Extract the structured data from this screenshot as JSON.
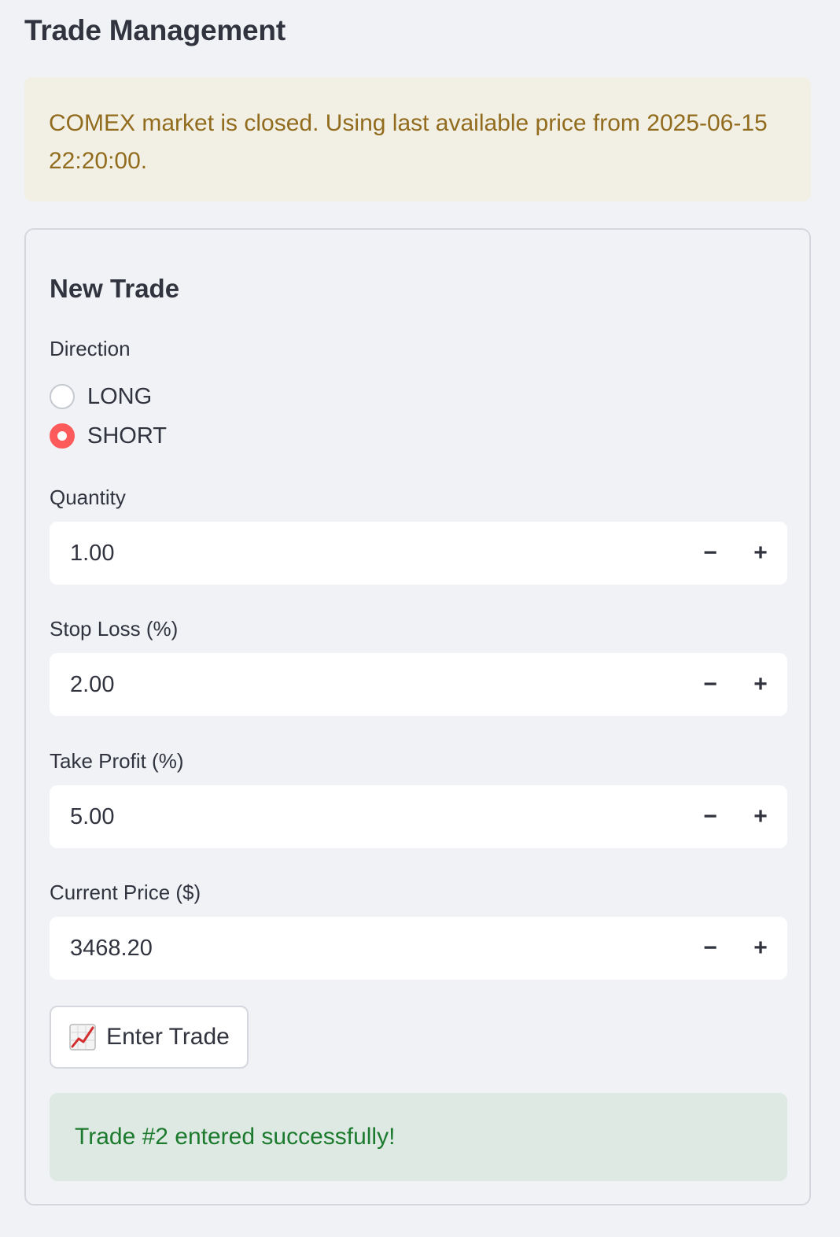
{
  "page": {
    "title": "Trade Management"
  },
  "alerts": {
    "warning": "COMEX market is closed. Using last available price from 2025-06-15 22:20:00.",
    "success": "Trade #2 entered successfully!"
  },
  "form": {
    "title": "New Trade",
    "direction": {
      "label": "Direction",
      "options": [
        "LONG",
        "SHORT"
      ],
      "selected": "SHORT"
    },
    "quantity": {
      "label": "Quantity",
      "value": "1.00"
    },
    "stop_loss": {
      "label": "Stop Loss (%)",
      "value": "2.00"
    },
    "take_profit": {
      "label": "Take Profit (%)",
      "value": "5.00"
    },
    "current_price": {
      "label": "Current Price ($)",
      "value": "3468.20"
    },
    "stepper": {
      "minus": "−",
      "plus": "+"
    },
    "submit": {
      "label": "Enter Trade",
      "icon": "chart-increasing-icon"
    }
  },
  "colors": {
    "accent": "#ff4b4b",
    "warning_bg": "#f2f0e4",
    "warning_text": "#926c1e",
    "success_bg": "#dfe9e3",
    "success_text": "#1c7a2e",
    "background": "#f0f2f6"
  }
}
